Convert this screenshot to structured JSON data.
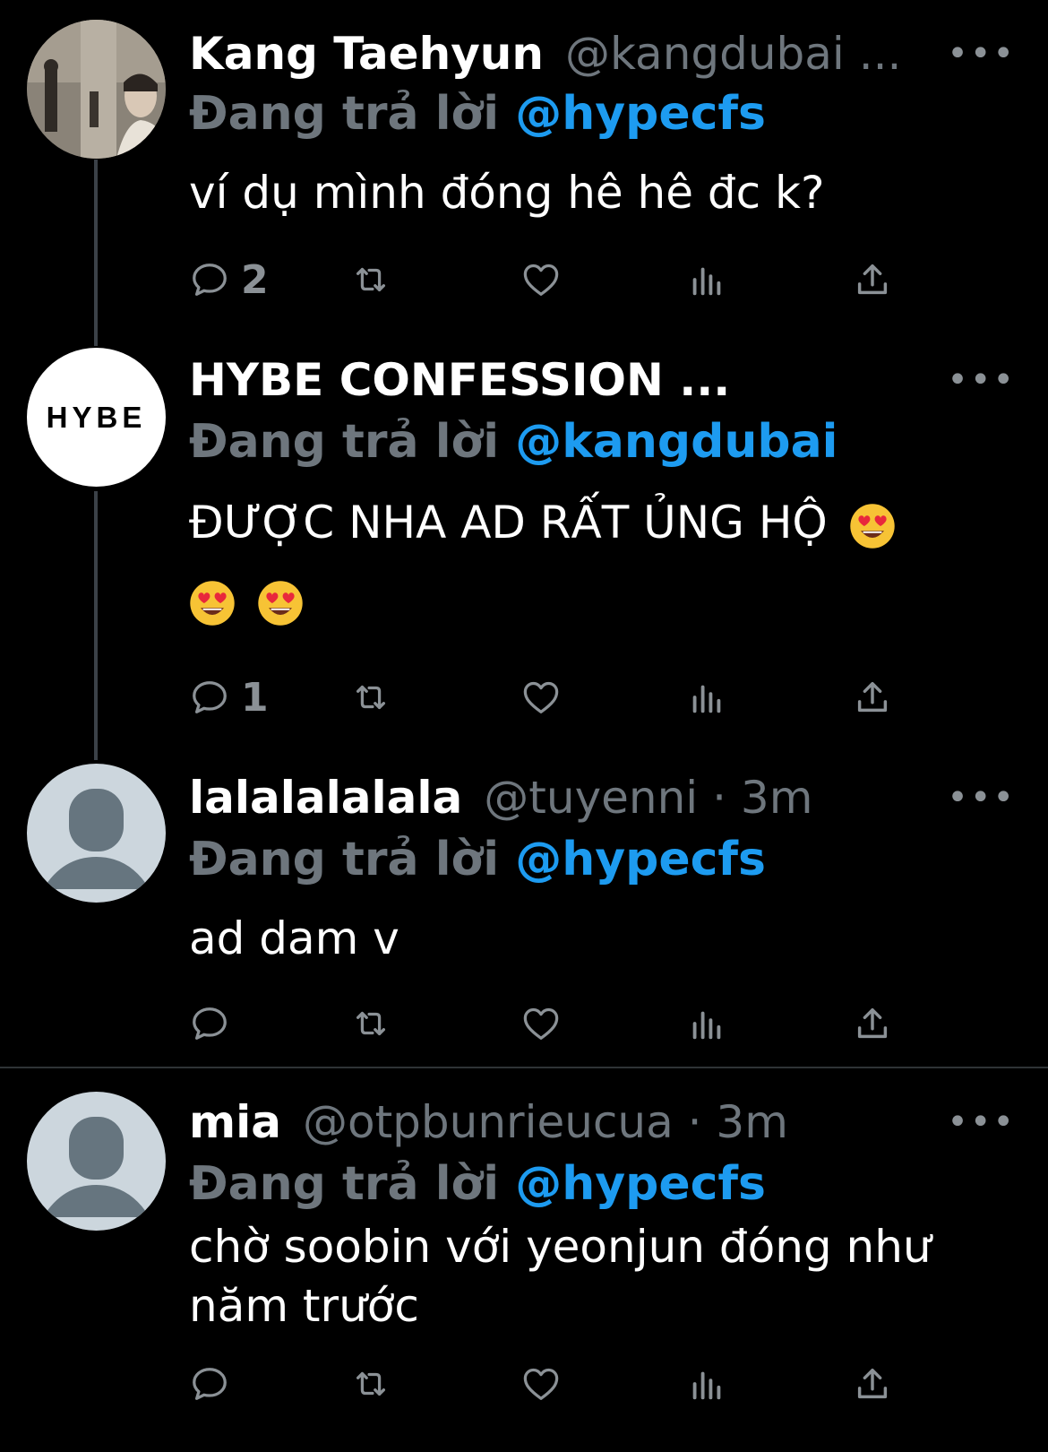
{
  "tweets": [
    {
      "name": "Kang Taehyun",
      "handle": "@kangdubai ...",
      "more": "•••",
      "replying_prefix": "Đang trả lời",
      "replying_to": "@hypecfs",
      "text": "ví dụ mình đóng hê hê đc k?",
      "reply_count": "2",
      "avatar": "photo"
    },
    {
      "name": "HYBE CONFESSION ...",
      "handle": "",
      "more": "•••",
      "replying_prefix": "Đang trả lời",
      "replying_to": "@kangdubai",
      "text": "ĐƯỢC NHA AD RẤT ỦNG HỘ",
      "reply_count": "1",
      "avatar_text": "HYBE",
      "emojis": [
        "smiling-face-with-heart-eyes",
        "smiling-face-with-heart-eyes",
        "smiling-face-with-heart-eyes"
      ]
    },
    {
      "name": "lalalalalala",
      "handle": "@tuyenni · 3m",
      "more": "•••",
      "replying_prefix": "Đang trả lời",
      "replying_to": "@hypecfs",
      "text": "ad dam v",
      "reply_count": "",
      "avatar": "default"
    },
    {
      "name": "mia",
      "handle": "@otpbunrieucua · 3m",
      "more": "•••",
      "replying_prefix": "Đang trả lời",
      "replying_to": "@hypecfs",
      "text": "chờ soobin với yeonjun đóng như năm trước",
      "reply_count": "",
      "avatar": "default"
    }
  ],
  "colors": {
    "accent": "#1d9bf0",
    "muted": "#6e767d",
    "icon": "#8b9196",
    "background": "#000000"
  }
}
